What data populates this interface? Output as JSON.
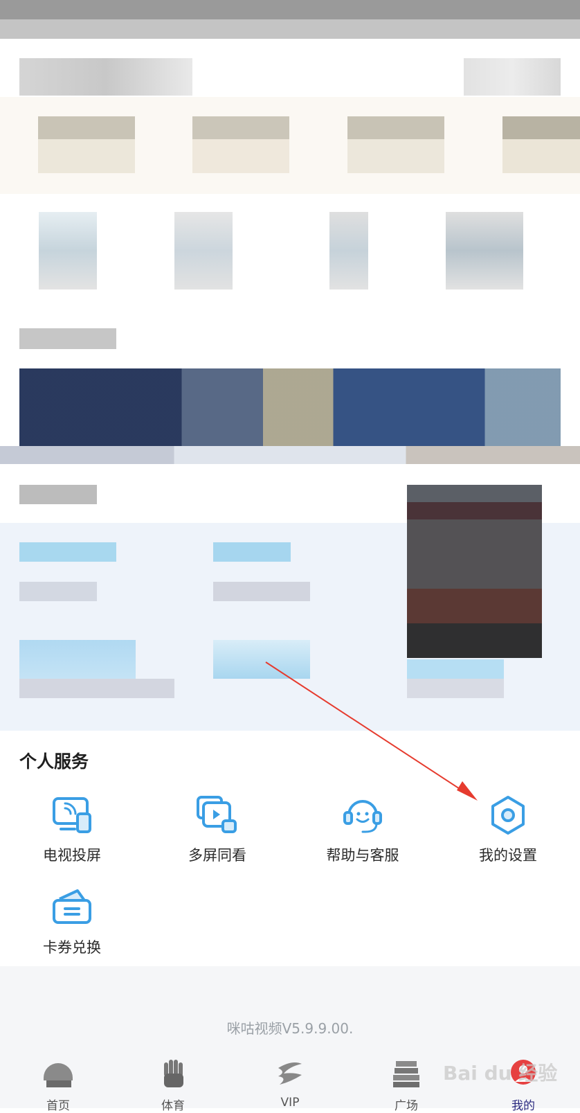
{
  "section": {
    "title": "个人服务"
  },
  "services": [
    {
      "label": "电视投屏",
      "icon": "tv-cast-icon"
    },
    {
      "label": "多屏同看",
      "icon": "multi-screen-icon"
    },
    {
      "label": "帮助与客服",
      "icon": "headset-icon"
    },
    {
      "label": "我的设置",
      "icon": "settings-hexagon-icon"
    },
    {
      "label": "卡券兑换",
      "icon": "coupon-wallet-icon"
    }
  ],
  "footer": {
    "version": "咪咕视频V5.9.9.00."
  },
  "tabs": [
    {
      "label": "首页",
      "icon": "home-helmet-icon"
    },
    {
      "label": "体育",
      "icon": "sports-glove-icon"
    },
    {
      "label": "VIP",
      "icon": "vip-icon"
    },
    {
      "label": "广场",
      "icon": "square-icon"
    },
    {
      "label": "我的",
      "icon": "profile-icon"
    }
  ],
  "watermark": "Bai du 经验",
  "colors": {
    "accent": "#3a9ee4",
    "arrow": "#e63b2e",
    "active_tab": "#2b2b80"
  }
}
